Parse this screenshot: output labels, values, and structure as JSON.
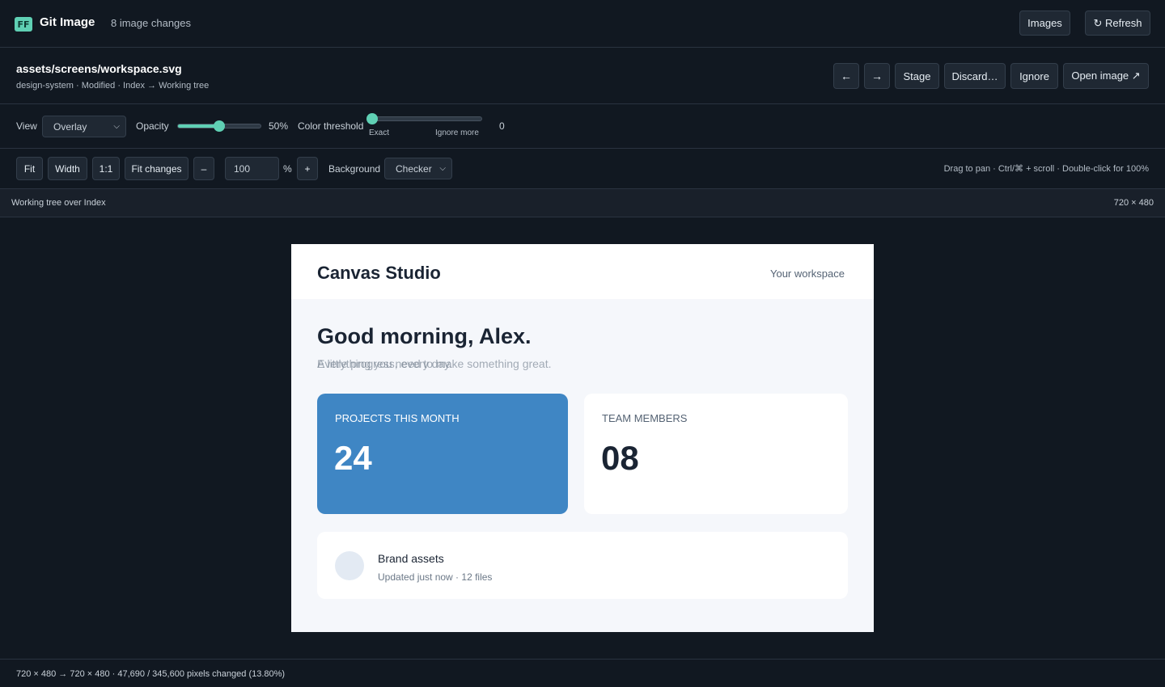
{
  "app": {
    "logo": "FF",
    "title": "Git Image",
    "change_count": "8 image changes",
    "images_label": "Images",
    "refresh_label": "↻ Refresh"
  },
  "file": {
    "path": "assets/screens/workspace.svg",
    "meta": "design-system · Modified · Index → Working tree",
    "prev_icon": "←",
    "next_icon": "→",
    "stage_label": "Stage",
    "discard_label": "Discard…",
    "ignore_label": "Ignore",
    "open_label": "Open image ↗"
  },
  "view": {
    "view_label": "View",
    "view_mode": "Overlay",
    "opacity_label": "Opacity",
    "opacity_value": "50%",
    "opacity_fraction": 0.5,
    "threshold_label": "Color threshold",
    "threshold_min_label": "Exact",
    "threshold_max_label": "Ignore more",
    "threshold_value": "0",
    "threshold_fraction": 0
  },
  "zoom": {
    "fit_label": "Fit",
    "width_label": "Width",
    "one_to_one_label": "1:1",
    "fit_changes_label": "Fit changes",
    "minus_label": "–",
    "value": "100",
    "percent_label": "%",
    "plus_label": "+",
    "background_label": "Background",
    "background_mode": "Checker",
    "hint": "Drag to pan · Ctrl/⌘ + scroll · Double-click for 100%"
  },
  "strip": {
    "left": "Working tree over Index",
    "right": "720 × 480"
  },
  "preview": {
    "brand": "Canvas Studio",
    "workspace": "Your workspace",
    "greeting": "Good morning, Alex.",
    "subtitle_a": "A little progress, every day.",
    "subtitle_b": "Everything you need to make something great.",
    "stat1_label": "PROJECTS THIS MONTH",
    "stat1_value": "24",
    "stat2_label": "TEAM MEMBERS",
    "stat2_value": "08",
    "item_title": "Brand assets",
    "item_meta": "Updated just now · 12 files"
  },
  "footer": {
    "text": "720 × 480 → 720 × 480 · 47,690 / 345,600 pixels changed (13.80%)"
  },
  "colors": {
    "accent": "#5fd0b4",
    "background": "#111821",
    "card_blue": "#3f86c4"
  },
  "icons": {
    "refresh": "refresh-icon",
    "prev": "arrow-left-icon",
    "next": "arrow-right-icon",
    "open": "external-link-icon",
    "chevron": "chevron-down-icon"
  }
}
